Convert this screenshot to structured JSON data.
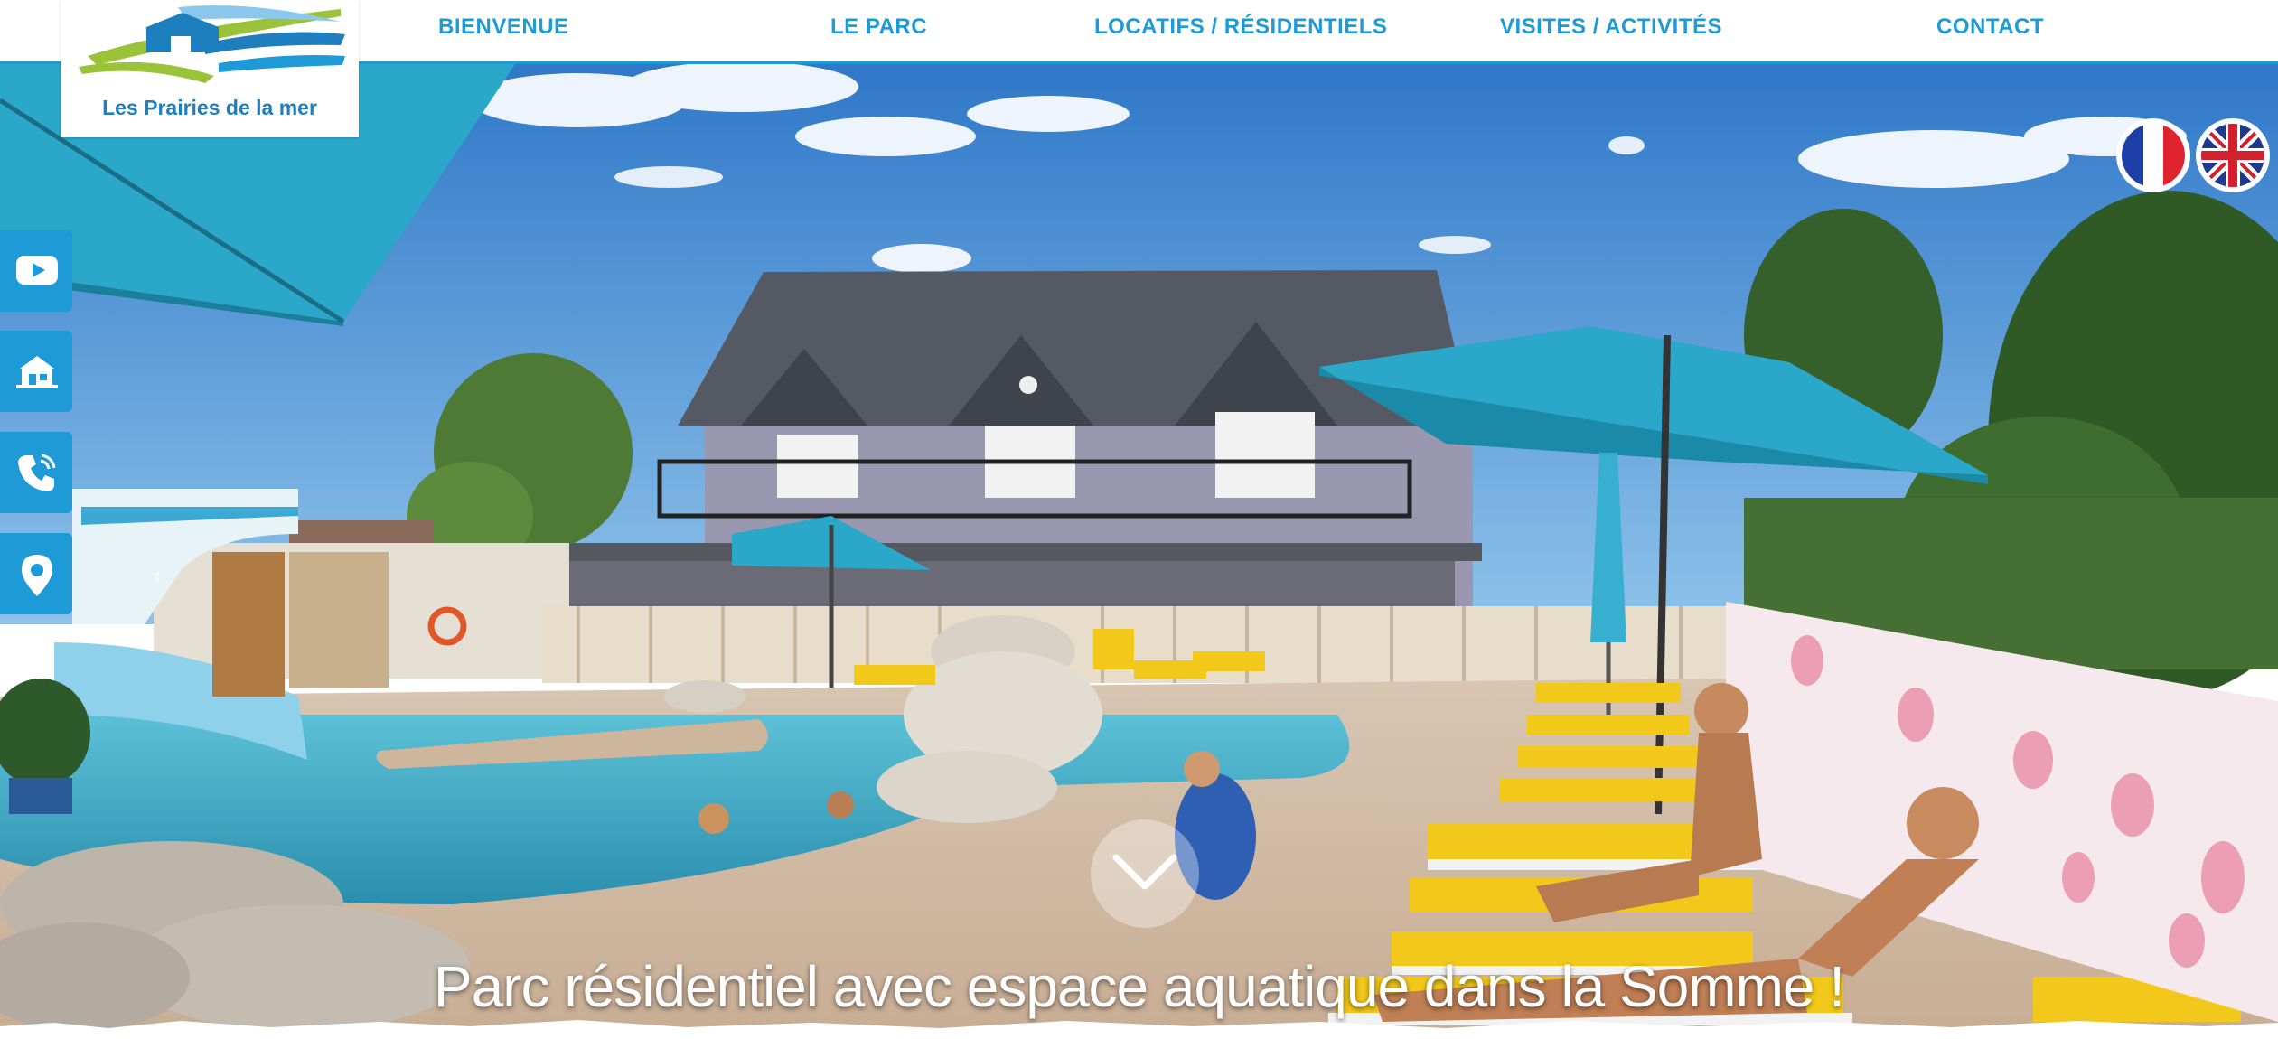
{
  "logo": {
    "name": "Les Prairies de la mer"
  },
  "nav": {
    "items": [
      {
        "label": "BIENVENUE"
      },
      {
        "label": "LE PARC"
      },
      {
        "label": "LOCATIFS / RÉSIDENTIELS"
      },
      {
        "label": "VISITES / ACTIVITÉS"
      },
      {
        "label": "CONTACT"
      }
    ]
  },
  "hero": {
    "caption": "Parc résidentiel avec espace aquatique dans la Somme !"
  },
  "side_buttons": [
    {
      "icon": "youtube-icon"
    },
    {
      "icon": "mobile-home-icon"
    },
    {
      "icon": "phone-icon"
    },
    {
      "icon": "map-pin-icon"
    }
  ],
  "languages": [
    {
      "code": "fr",
      "icon": "french-flag-icon"
    },
    {
      "code": "en",
      "icon": "uk-flag-icon"
    }
  ],
  "colors": {
    "brand_blue": "#1e9ad6",
    "logo_green": "#9bc33a",
    "pool_water": "#3fa9c4",
    "chair_yellow": "#f2c81a",
    "umbrella_teal": "#2aa7c9"
  }
}
